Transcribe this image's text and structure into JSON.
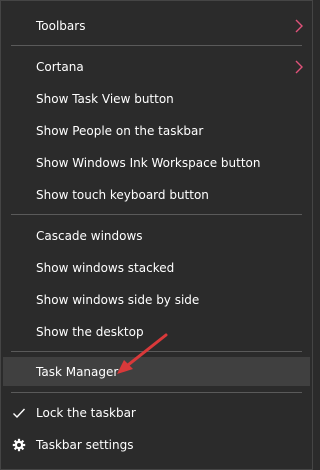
{
  "menu": {
    "items": [
      {
        "label": "Toolbars"
      },
      {
        "label": "Cortana"
      },
      {
        "label": "Show Task View button"
      },
      {
        "label": "Show People on the taskbar"
      },
      {
        "label": "Show Windows Ink Workspace button"
      },
      {
        "label": "Show touch keyboard button"
      },
      {
        "label": "Cascade windows"
      },
      {
        "label": "Show windows stacked"
      },
      {
        "label": "Show windows side by side"
      },
      {
        "label": "Show the desktop"
      },
      {
        "label": "Task Manager"
      },
      {
        "label": "Lock the taskbar"
      },
      {
        "label": "Taskbar settings"
      }
    ]
  },
  "colors": {
    "menu_background": "#2b2b2b",
    "highlight_background": "#404040",
    "text": "#ffffff",
    "separator": "#5a5a5a",
    "chevron_accent": "#e0527a",
    "annotation_arrow": "#d9393a"
  },
  "icons": {
    "submenu": "chevron-right-icon",
    "checked": "checkmark-icon",
    "settings": "gear-icon",
    "annotation": "red-arrow-icon"
  }
}
